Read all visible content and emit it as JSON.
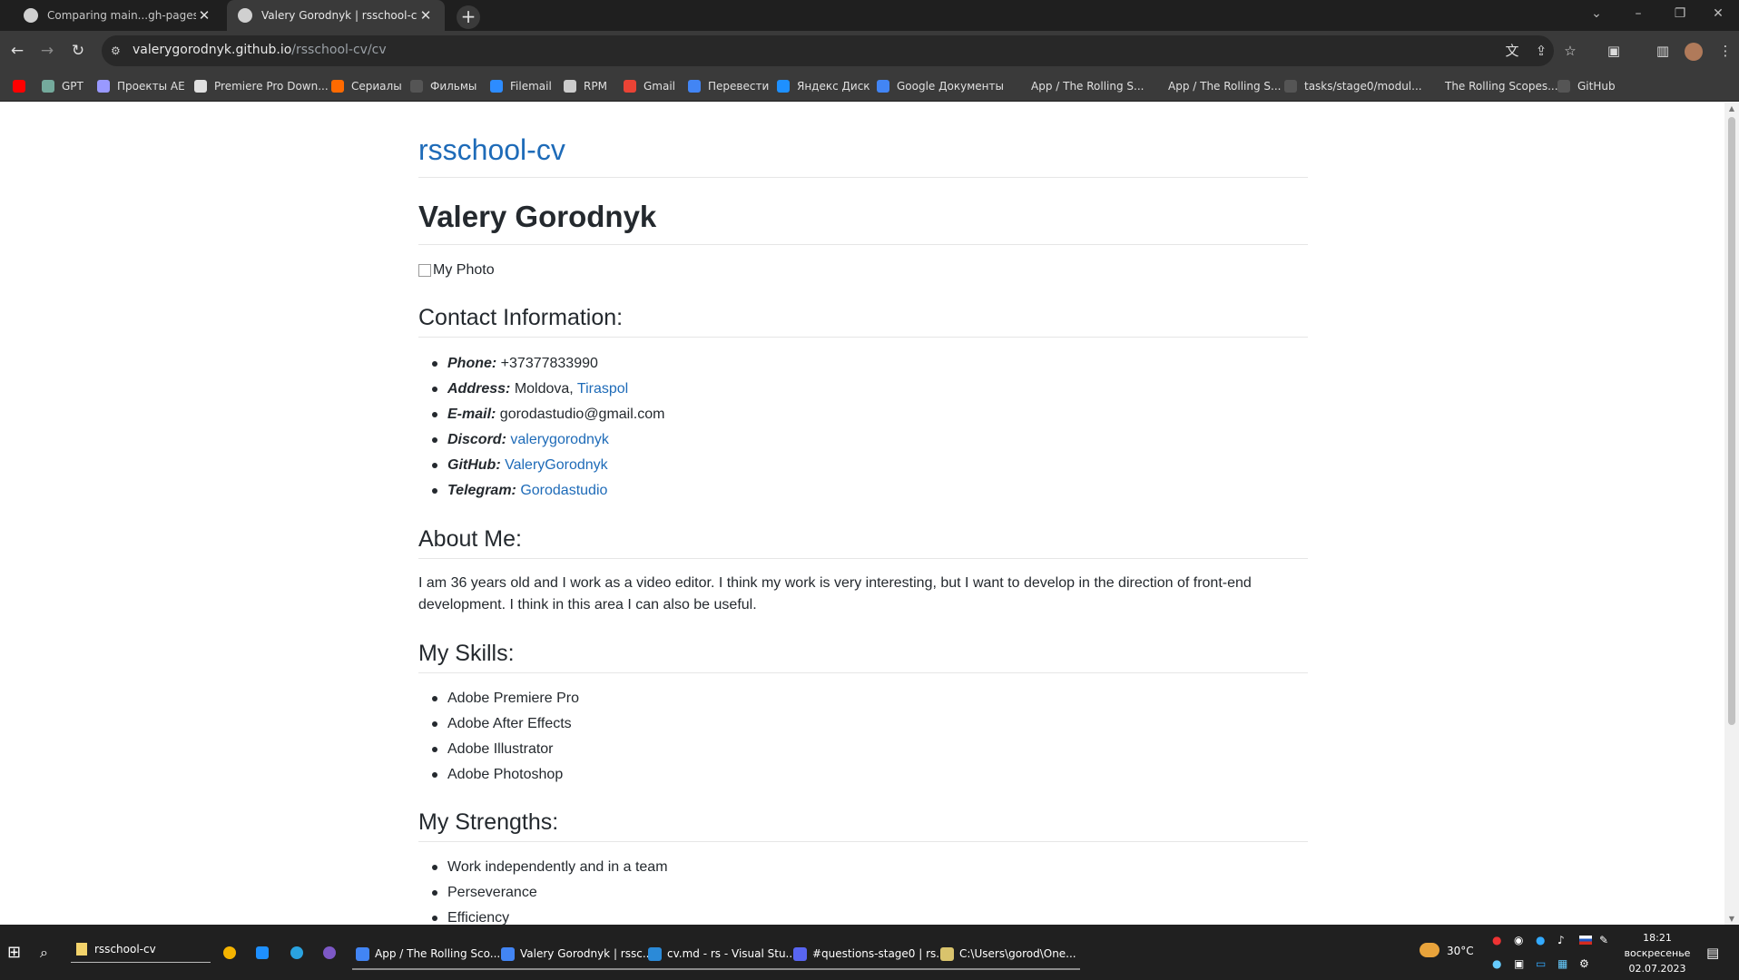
{
  "browser": {
    "tabs": [
      {
        "title": "Comparing main...gh-pages · Va",
        "active": false
      },
      {
        "title": "Valery Gorodnyk | rsschool-cv",
        "active": true
      }
    ],
    "url_host": "valerygorodnyk.github.io",
    "url_path": "/rsschool-cv/cv",
    "bookmarks": [
      {
        "label": "",
        "color": "#ff0000"
      },
      {
        "label": "GPT",
        "color": "#74aa9c"
      },
      {
        "label": "Проекты AE",
        "color": "#9999ff"
      },
      {
        "label": "Premiere Pro Down...",
        "color": "#e0e0e0"
      },
      {
        "label": "Сериалы",
        "color": "#ff6a00"
      },
      {
        "label": "Фильмы",
        "color": "#555555"
      },
      {
        "label": "Filemail",
        "color": "#2d8cff"
      },
      {
        "label": "RPM",
        "color": "#cccccc"
      },
      {
        "label": "Gmail",
        "color": "#ea4335"
      },
      {
        "label": "Перевести",
        "color": "#4285f4"
      },
      {
        "label": "Яндекс Диск",
        "color": "#1e90ff"
      },
      {
        "label": "Google Документы",
        "color": "#4285f4"
      },
      {
        "label": "App / The Rolling S...",
        "color": "#3a3a3a"
      },
      {
        "label": "App / The Rolling S...",
        "color": "#3a3a3a"
      },
      {
        "label": "tasks/stage0/modul...",
        "color": "#555555"
      },
      {
        "label": "The Rolling Scopes...",
        "color": "#3a3a3a"
      },
      {
        "label": "GitHub",
        "color": "#555555"
      }
    ]
  },
  "page": {
    "site_title": "rsschool-cv",
    "name": "Valery Gorodnyk",
    "photo_alt": "My Photo",
    "contact_heading": "Contact Information:",
    "contacts": [
      {
        "label": "Phone:",
        "value": "+37377833990",
        "link": false
      },
      {
        "label": "Address:",
        "value": "Moldova, ",
        "link_text": "Tiraspol"
      },
      {
        "label": "E-mail:",
        "value": "gorodastudio@gmail.com",
        "link": false
      },
      {
        "label": "Discord:",
        "value": "",
        "link_text": "valerygorodnyk"
      },
      {
        "label": "GitHub:",
        "value": "",
        "link_text": "ValeryGorodnyk"
      },
      {
        "label": "Telegram:",
        "value": "",
        "link_text": "Gorodastudio"
      }
    ],
    "about_heading": "About Me:",
    "about_text": "I am 36 years old and I work as a video editor. I think my work is very interesting, but I want to develop in the direction of front-end development. I think in this area I can also be useful.",
    "skills_heading": "My Skills:",
    "skills": [
      "Adobe Premiere Pro",
      "Adobe After Effects",
      "Adobe Illustrator",
      "Adobe Photoshop"
    ],
    "strengths_heading": "My Strengths:",
    "strengths": [
      "Work independently and in a team",
      "Perseverance",
      "Efficiency"
    ]
  },
  "taskbar": {
    "search_text": "rsschool-cv",
    "apps": [
      {
        "label": "App / The Rolling Sco...",
        "color": "#4285f4"
      },
      {
        "label": "Valery Gorodnyk | rssc...",
        "color": "#4285f4"
      },
      {
        "label": "cv.md - rs - Visual Stu...",
        "color": "#2b8ad8"
      },
      {
        "label": "#questions-stage0 | rs...",
        "color": "#5865f2"
      },
      {
        "label": "C:\\Users\\gorod\\One...",
        "color": "#d9c36c"
      }
    ],
    "weather": "30°C",
    "time": "18:21",
    "day": "воскресенье",
    "date": "02.07.2023"
  }
}
